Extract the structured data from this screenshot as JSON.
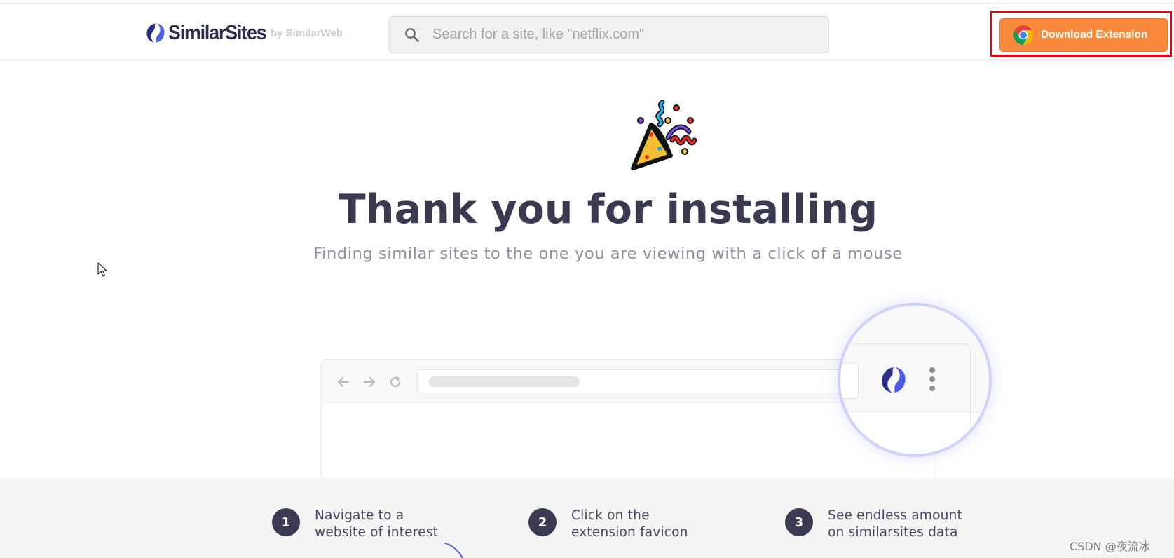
{
  "header": {
    "logo_text": "SimilarSites",
    "logo_sub": "by SimilarWeb",
    "search_placeholder": "Search for a site, like \"netflix.com\"",
    "download_label": "Download Extension"
  },
  "hero": {
    "title": "Thank you for installing",
    "subtitle": "Finding similar sites to the one you are viewing with a click of a mouse"
  },
  "steps": [
    {
      "number": "1",
      "line1": "Navigate to a",
      "line2": "website of interest"
    },
    {
      "number": "2",
      "line1": "Click on the",
      "line2": "extension favicon"
    },
    {
      "number": "3",
      "line1": "See endless amount",
      "line2": "on similarsites data"
    }
  ],
  "watermark": "CSDN @夜流冰",
  "icons": {
    "logo": "similarsites-logo-icon",
    "search": "search-icon",
    "chrome": "chrome-icon",
    "party": "party-popper-icon",
    "extension": "similarsites-extension-icon",
    "menu": "kebab-menu-icon"
  },
  "colors": {
    "brand_dark": "#2b2c4d",
    "brand_blue": "#3b3fd8",
    "download_orange": "#f9893d",
    "highlight_red": "#e60012",
    "step_badge": "#3a3a52"
  }
}
